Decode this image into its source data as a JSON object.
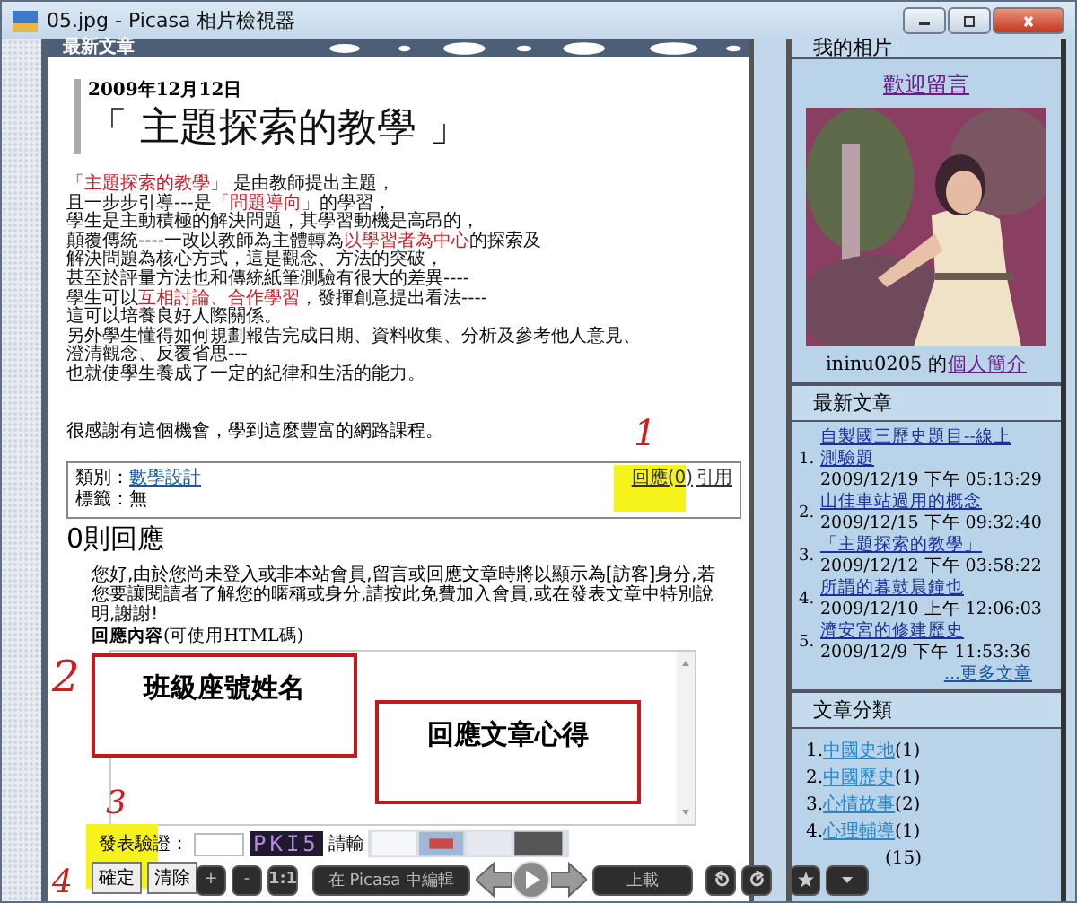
{
  "window": {
    "title": "05.jpg - Picasa 相片檢視器"
  },
  "article": {
    "section_header": "最新文章",
    "date": "2009年12月12日",
    "title": "「 主題探索的教學 」",
    "lines": [
      [
        {
          "text": "「主題探索的教學」",
          "highlight": true
        },
        {
          "text": " 是由教師提出主題，",
          "highlight": false
        }
      ],
      [
        {
          "text": "且一步步引導---是",
          "highlight": false
        },
        {
          "text": "「問題導向」",
          "highlight": true
        },
        {
          "text": "的學習，",
          "highlight": false
        }
      ],
      [
        {
          "text": "學生是主動積極的解決問題，其學習動機是高昂的，",
          "highlight": false
        }
      ],
      [
        {
          "text": "顛覆傳統----一改以教師為主體轉為",
          "highlight": false
        },
        {
          "text": "以學習者為中心",
          "highlight": true
        },
        {
          "text": "的探索及",
          "highlight": false
        }
      ],
      [
        {
          "text": "解決問題為核心方式，這是觀念、方法的突破，",
          "highlight": false
        }
      ],
      [
        {
          "text": "甚至於評量方法也和傳統紙筆測驗有很大的差異----",
          "highlight": false
        }
      ],
      [
        {
          "text": "學生可以",
          "highlight": false
        },
        {
          "text": "互相討論、合作學習",
          "highlight": true
        },
        {
          "text": "，發揮創意提出看法----",
          "highlight": false
        }
      ],
      [
        {
          "text": "這可以培養良好人際關係。",
          "highlight": false
        }
      ],
      [
        {
          "text": "另外學生懂得如何規劃報告完成日期、資料收集、分析及參考他人意見、",
          "highlight": false
        }
      ],
      [
        {
          "text": "澄清觀念、反覆省思---",
          "highlight": false
        }
      ],
      [
        {
          "text": "也就使學生養成了一定的紀律和生活的能力。",
          "highlight": false
        }
      ]
    ],
    "thanks": "很感謝有這個機會，學到這麼豐富的網路課程。",
    "meta": {
      "category_label": "類別：",
      "category": "數學設計",
      "tags_label": "標籤：",
      "tags": "無",
      "reply_link": "回應(0)",
      "quote_link": "引用"
    }
  },
  "comments": {
    "count": "0則回應",
    "notice": "您好,由於您尚未登入或非本站會員,留言或回應文章時將以顯示為[訪客]身分,若您要讓閱讀者了解您的暱稱或身分,請按此免費加入會員,或在發表文章中特別說明,謝謝!",
    "content_label": "**回應內容**(可使用HTML碼)",
    "notes": [
      "班級座號姓名",
      "回應文章心得"
    ],
    "captcha_label": "發表驗證：",
    "captcha_code": "PKI5",
    "captcha_hint": "請輸",
    "buttons": [
      "確定",
      "清除"
    ]
  },
  "annotations": [
    "1",
    "2",
    "3",
    "4"
  ],
  "sidebar": {
    "photos_header": "我的相片",
    "welcome": "歡迎留言",
    "profile_user": "ininu0205 的",
    "profile_link": "個人簡介",
    "recent_header": "最新文章",
    "recent": [
      {
        "num": "1.",
        "title": "自製國三歷史題目--線上測驗題",
        "time": "2009/12/19 下午 05:13:29"
      },
      {
        "num": "2.",
        "title": "山佳車站過用的概念",
        "time": "2009/12/15 下午 09:32:40"
      },
      {
        "num": "3.",
        "title": "「主題探索的教學」",
        "time": "2009/12/12 下午 03:58:22"
      },
      {
        "num": "4.",
        "title": "所謂的暮鼓晨鐘也",
        "time": "2009/12/10 上午 12:06:03"
      },
      {
        "num": "5.",
        "title": "濟安宮的修建歷史",
        "time": "2009/12/9 下午 11:53:36"
      }
    ],
    "more": "...更多文章",
    "categories_header": "文章分類",
    "categories": [
      {
        "num": "1.",
        "name": "中國史地",
        "count": "(1)"
      },
      {
        "num": "2.",
        "name": "中國歷史",
        "count": "(1)"
      },
      {
        "num": "3.",
        "name": "心情故事",
        "count": "(2)"
      },
      {
        "num": "4.",
        "name": "心理輔導",
        "count": "(1)"
      },
      {
        "count": "(15)"
      }
    ]
  },
  "viewer_toolbar": {
    "zoom_buttons": [
      "+",
      "-",
      "1:1"
    ],
    "edit_button": "在 Picasa 中編輯",
    "upload_button": "上載"
  }
}
